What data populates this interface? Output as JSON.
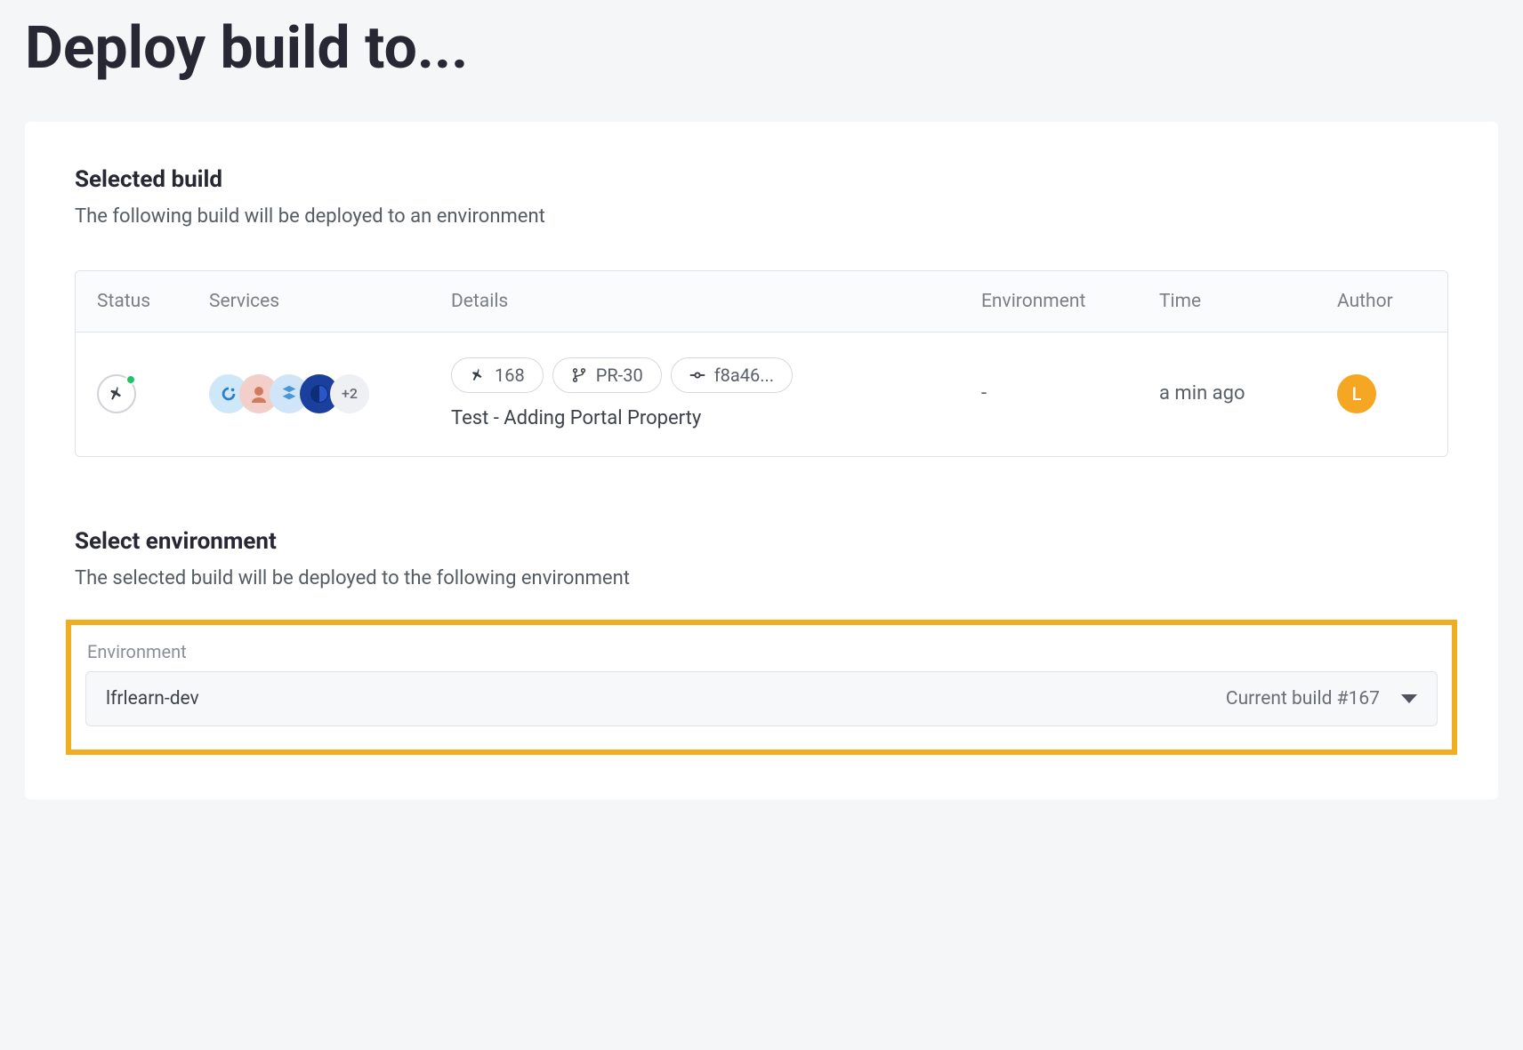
{
  "page_title": "Deploy build to...",
  "selected_build": {
    "heading": "Selected build",
    "subtext": "The following build will be deployed to an environment",
    "columns": {
      "status": "Status",
      "services": "Services",
      "details": "Details",
      "environment": "Environment",
      "time": "Time",
      "author": "Author"
    },
    "row": {
      "status_indicator": "success",
      "services_more": "+2",
      "pills": {
        "build_number": "168",
        "branch": "PR-30",
        "commit": "f8a46..."
      },
      "description": "Test - Adding Portal Property",
      "environment": "-",
      "time": "a min ago",
      "author_initial": "L"
    }
  },
  "select_environment": {
    "heading": "Select environment",
    "subtext": "The selected build will be deployed to the following environment",
    "field_label": "Environment",
    "selected_env": "lfrlearn-dev",
    "current_build": "Current build #167"
  }
}
